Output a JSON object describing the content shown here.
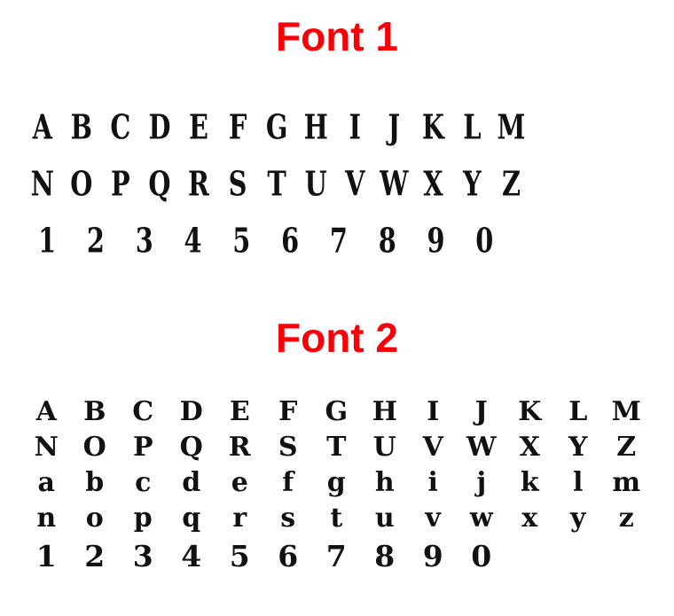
{
  "page": {
    "background_color": "#ffffff",
    "text_color": "#111111",
    "title_color": "#fb0007"
  },
  "specimens": [
    {
      "id": "font-1",
      "title": "Font 1",
      "style_note": "condensed slab serif / collegiate",
      "rows": [
        {
          "id": "uppercase-a-m",
          "glyphs": [
            "A",
            "B",
            "C",
            "D",
            "E",
            "F",
            "G",
            "H",
            "I",
            "J",
            "K",
            "L",
            "M"
          ]
        },
        {
          "id": "uppercase-n-z",
          "glyphs": [
            "N",
            "O",
            "P",
            "Q",
            "R",
            "S",
            "T",
            "U",
            "V",
            "W",
            "X",
            "Y",
            "Z"
          ]
        },
        {
          "id": "digits",
          "glyphs": [
            "1",
            "2",
            "3",
            "4",
            "5",
            "6",
            "7",
            "8",
            "9",
            "0"
          ]
        }
      ]
    },
    {
      "id": "font-2",
      "title": "Font 2",
      "style_note": "heavy old-style serif",
      "rows": [
        {
          "id": "uppercase-a-m",
          "glyphs": [
            "A",
            "B",
            "C",
            "D",
            "E",
            "F",
            "G",
            "H",
            "I",
            "J",
            "K",
            "L",
            "M"
          ]
        },
        {
          "id": "uppercase-n-z",
          "glyphs": [
            "N",
            "O",
            "P",
            "Q",
            "R",
            "S",
            "T",
            "U",
            "V",
            "W",
            "X",
            "Y",
            "Z"
          ]
        },
        {
          "id": "lowercase-a-m",
          "glyphs": [
            "a",
            "b",
            "c",
            "d",
            "e",
            "f",
            "g",
            "h",
            "i",
            "j",
            "k",
            "l",
            "m"
          ]
        },
        {
          "id": "lowercase-n-z",
          "glyphs": [
            "n",
            "o",
            "p",
            "q",
            "r",
            "s",
            "t",
            "u",
            "v",
            "w",
            "x",
            "y",
            "z"
          ]
        },
        {
          "id": "digits",
          "glyphs": [
            "1",
            "2",
            "3",
            "4",
            "5",
            "6",
            "7",
            "8",
            "9",
            "0"
          ]
        }
      ]
    }
  ]
}
